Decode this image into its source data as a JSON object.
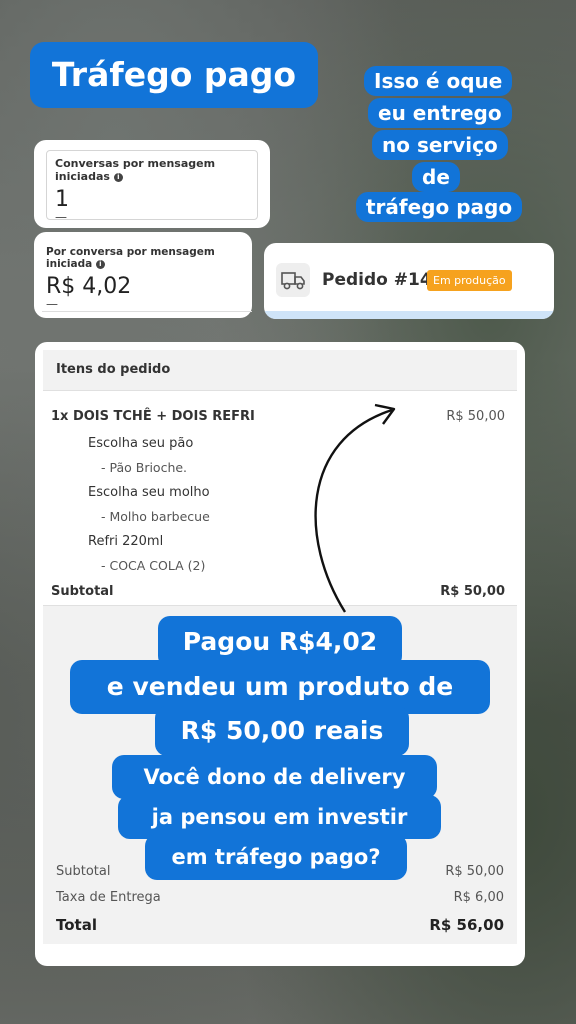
{
  "headline": "Tráfego pago",
  "side_note": [
    "Isso é oque",
    "eu entrego",
    "no serviço",
    "de",
    "tráfego pago"
  ],
  "stat1": {
    "label": "Conversas por mensagem iniciadas",
    "value": "1",
    "dash": "—"
  },
  "stat2": {
    "label": "Por conversa por mensagem iniciada",
    "value": "R$ 4,02",
    "dash": "—"
  },
  "order": {
    "icon": "delivery-truck-icon",
    "title": "Pedido #14",
    "status": "Em produção",
    "status_color": "#f6a21e"
  },
  "items": {
    "header": "Itens do pedido",
    "product": "1x DOIS TCHÊ + DOIS REFRI",
    "product_price": "R$ 50,00",
    "options": [
      {
        "group": "Escolha seu pão",
        "choice": "- Pão Brioche."
      },
      {
        "group": "Escolha seu molho",
        "choice": "- Molho barbecue"
      },
      {
        "group": "Refri 220ml",
        "choice": "- COCA COLA (2)"
      }
    ],
    "subtotal_label": "Subtotal",
    "subtotal_value": "R$ 50,00"
  },
  "totals": {
    "subtotal_label": "Subtotal",
    "subtotal_value": "R$ 50,00",
    "delivery_label": "Taxa de Entrega",
    "delivery_value": "R$ 6,00",
    "total_label": "Total",
    "total_value": "R$ 56,00"
  },
  "promo": [
    "Pagou R$4,02",
    "e vendeu um produto de",
    "R$ 50,00 reais",
    "Você dono de delivery",
    "ja pensou em investir",
    "em tráfego pago?"
  ],
  "accent_color": "#1274d8"
}
